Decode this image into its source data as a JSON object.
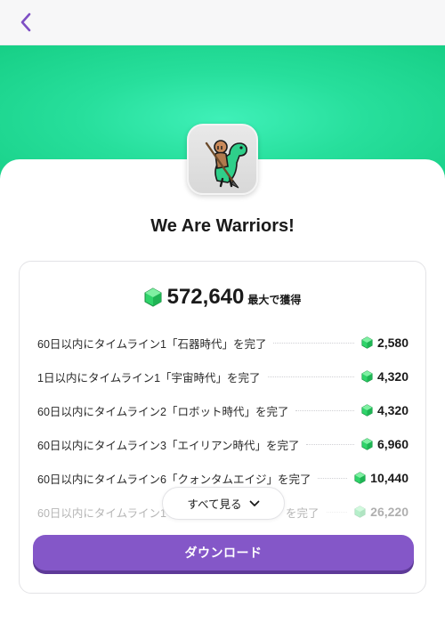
{
  "colors": {
    "accent": "#8457c8",
    "hero_green": "#27df9c",
    "gem_green": "#2fd46a"
  },
  "nav": {
    "back_icon": "chevron-left-icon"
  },
  "app": {
    "name": "We Are Warriors!",
    "icon": "caveman-riding-dinosaur-icon"
  },
  "rewards": {
    "total_value": "572,640",
    "total_suffix": "最大で獲得",
    "currency_icon": "gem-icon",
    "tasks": [
      {
        "label": "60日以内にタイムライン1「石器時代」を完了",
        "value": "2,580"
      },
      {
        "label": "1日以内にタイムライン1「宇宙時代」を完了",
        "value": "4,320"
      },
      {
        "label": "60日以内にタイムライン2「ロボット時代」を完了",
        "value": "4,320"
      },
      {
        "label": "60日以内にタイムライン3「エイリアン時代」を完了",
        "value": "6,960"
      },
      {
        "label": "60日以内にタイムライン6「クォンタムエイジ」を完了",
        "value": "10,440"
      },
      {
        "label": "60日以内にタイムライン1",
        "label_tail": "を完了",
        "value": "26,220"
      }
    ],
    "see_all_label": "すべて見る",
    "see_all_icon": "chevron-down-icon"
  },
  "cta": {
    "download_label": "ダウンロード"
  }
}
